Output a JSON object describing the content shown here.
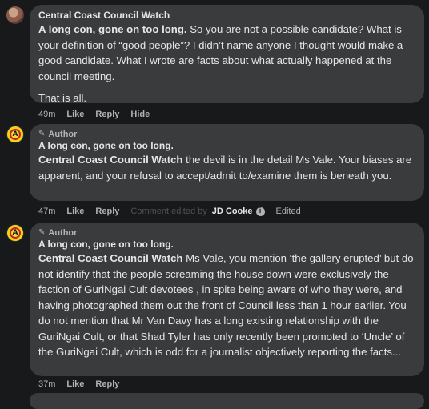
{
  "comments": [
    {
      "author": "Central Coast Council Watch",
      "lead": "A long con, gone on too long.",
      "body": " So you are not a possible candidate? What is your definition of “good people”? I didn’t name anyone I thought would make a good candidate. What I wrote are facts about what actually happened at the council meeting.",
      "body2": "That is all.",
      "time": "49m",
      "actions": [
        "Like",
        "Reply",
        "Hide"
      ]
    },
    {
      "badge": "Author",
      "author": "A long con, gone on too long.",
      "mention": "Central Coast Council Watch",
      "body": " the devil is in the detail Ms Vale. Your biases are apparent, and your refusal to accept/admit to/examine them is beneath you.",
      "time": "47m",
      "actions": [
        "Like",
        "Reply"
      ],
      "faded_text": "Comment edited by",
      "editor": "JD Cooke",
      "edited": "Edited"
    },
    {
      "badge": "Author",
      "author": "A long con, gone on too long.",
      "mention": "Central Coast Council Watch",
      "body": " Ms Vale, you mention ‘the gallery erupted’ but do not identify that the people screaming the house down were exclusively the faction of GuriNgai Cult devotees , in spite being aware of who they were, and having photographed them out the front of Council less than 1 hour earlier. You do not mention that Mr Van Davy has a long existing relationship with the GuriNgai Cult, or that Shad Tyler has only recently been promoted to ‘Uncle’ of the GuriNgai Cult, which is odd for a journalist objectively reporting the facts...",
      "time": "37m",
      "actions": [
        "Like",
        "Reply"
      ]
    }
  ],
  "icons": {
    "pencil": "✎",
    "info": "i",
    "logo": "A"
  }
}
